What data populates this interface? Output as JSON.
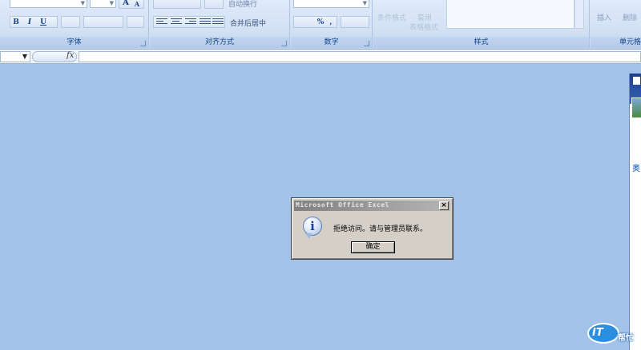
{
  "ribbon": {
    "groups": {
      "font": "字体",
      "alignment": "对齐方式",
      "number": "数字",
      "styles": "样式",
      "cells": "单元格"
    },
    "buttons": {
      "bold": "B",
      "italic": "I",
      "underline": "U",
      "grow_font": "A",
      "shrink_font": "A",
      "wrap_text": "自动换行",
      "merge_center": "合并后居中",
      "percent": "%",
      "comma": ",",
      "conditional_format": "条件格式",
      "format_table_1": "套用",
      "format_table_2": "表格格式",
      "insert": "插入",
      "delete": "删除"
    }
  },
  "formula_bar": {
    "fx": "fx"
  },
  "side_panel": {
    "text": "奥"
  },
  "watermark": {
    "main": "IT",
    "sub": "帮忙"
  },
  "dialog": {
    "title": "Microsoft Office Excel",
    "close": "×",
    "message": "拒绝访问。请与管理员联系。",
    "ok": "确定"
  }
}
